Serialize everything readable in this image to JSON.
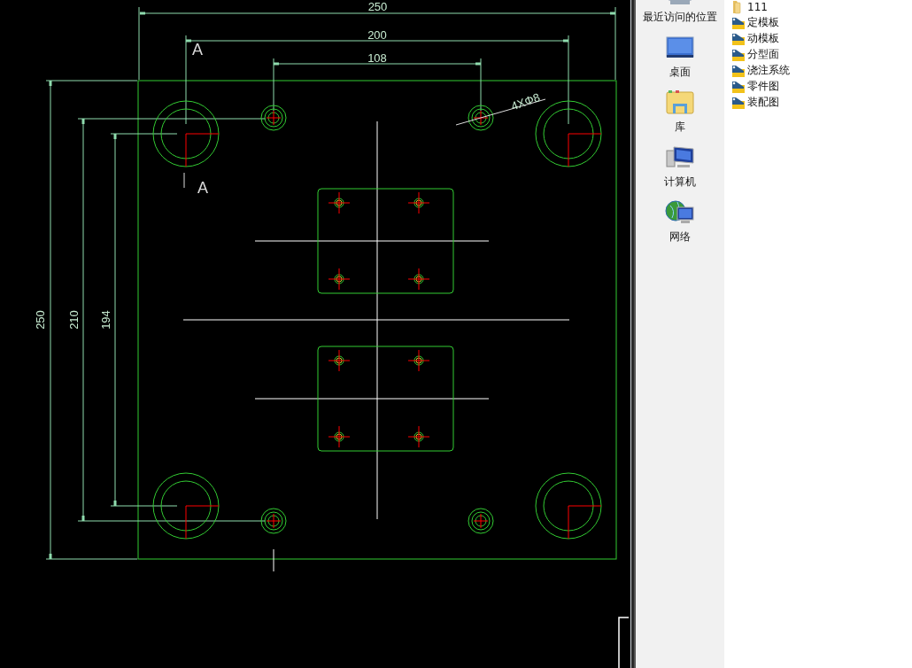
{
  "drawing": {
    "dimension_labels": [
      "250",
      "200",
      "108",
      "250",
      "210",
      "194"
    ],
    "section_labels": [
      "A",
      "A"
    ],
    "hole_callout": "4XΦ8"
  },
  "navigation_pane": {
    "items": [
      {
        "label": "最近访问的位置",
        "kind": "recent"
      },
      {
        "label": "桌面",
        "kind": "desktop"
      },
      {
        "label": "库",
        "kind": "library"
      },
      {
        "label": "计算机",
        "kind": "computer"
      },
      {
        "label": "网络",
        "kind": "network"
      }
    ]
  },
  "file_list": {
    "items": [
      {
        "name": "111",
        "kind": "folder"
      },
      {
        "name": "定模板",
        "kind": "shortcut-folder"
      },
      {
        "name": "动模板",
        "kind": "shortcut-folder"
      },
      {
        "name": "分型面",
        "kind": "shortcut-folder"
      },
      {
        "name": "浇注系统",
        "kind": "shortcut-folder"
      },
      {
        "name": "零件图",
        "kind": "shortcut-folder"
      },
      {
        "name": "装配图",
        "kind": "shortcut-folder"
      }
    ]
  }
}
